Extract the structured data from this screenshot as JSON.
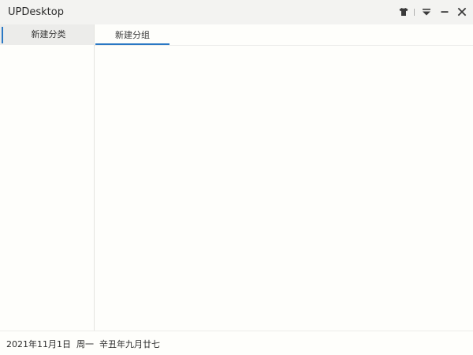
{
  "window": {
    "title": "UPDesktop"
  },
  "titlebar": {
    "buttons": [
      {
        "name": "skin",
        "icon": "tshirt-icon"
      },
      {
        "name": "menu",
        "icon": "dropdown-menu-icon"
      },
      {
        "name": "minimize",
        "icon": "minimize-icon"
      },
      {
        "name": "close",
        "icon": "close-icon"
      }
    ]
  },
  "sidebar": {
    "items": [
      {
        "label": "新建分类",
        "selected": true
      }
    ]
  },
  "main": {
    "tabs": [
      {
        "label": "新建分组",
        "active": true
      }
    ]
  },
  "status": {
    "text": "2021年11月1日  周一  辛丑年九月廿七"
  },
  "colors": {
    "accent": "#2a78c4",
    "titlebar_bg": "#f3f3f1",
    "content_bg": "#fefefb",
    "selected_bg": "#ececea"
  }
}
